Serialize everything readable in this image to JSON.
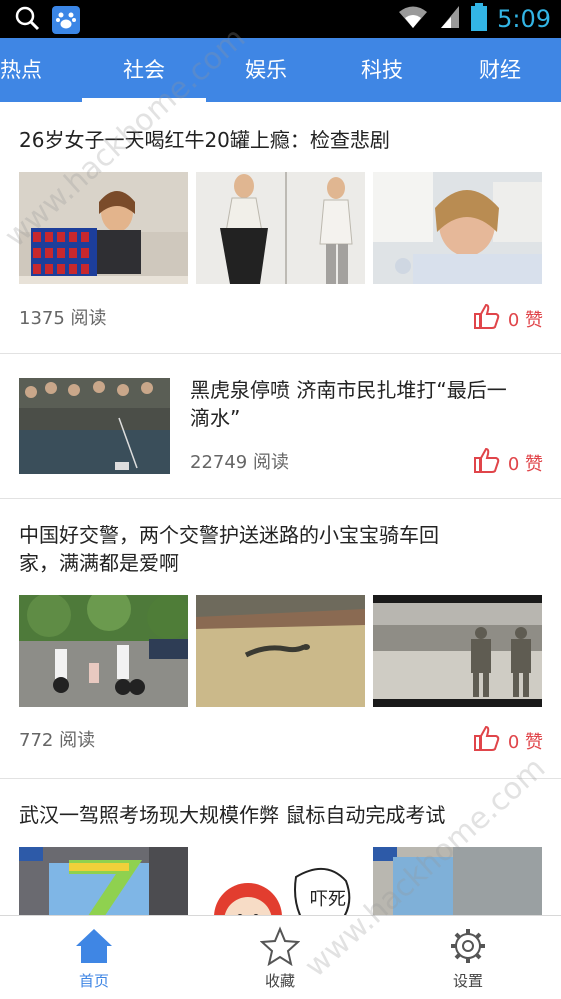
{
  "status_bar": {
    "time": "5:09"
  },
  "tabs": [
    {
      "label": "热点"
    },
    {
      "label": "社会"
    },
    {
      "label": "娱乐"
    },
    {
      "label": "科技"
    },
    {
      "label": "财经"
    }
  ],
  "articles": [
    {
      "title": "26岁女子一天喝红牛20罐上瘾：检查悲剧",
      "reads": "1375 阅读",
      "likes": "0 赞"
    },
    {
      "title_line1": "黑虎泉停喷 济南市民扎堆打“最后一",
      "title_line2": "滴水”",
      "reads": "22749 阅读",
      "likes": "0 赞"
    },
    {
      "title_line1": "中国好交警，两个交警护送迷路的小宝宝骑车回",
      "title_line2": "家，满满都是爱啊",
      "reads": "772 阅读",
      "likes": "0 赞"
    },
    {
      "title": "武汉一驾照考场现大规模作弊 鼠标自动完成考试"
    }
  ],
  "bottom_nav": [
    {
      "label": "首页"
    },
    {
      "label": "收藏"
    },
    {
      "label": "设置"
    }
  ],
  "watermark": {
    "text": "www.hackhome.com"
  },
  "colors": {
    "accent": "#3f86e4",
    "like": "#e0454a",
    "status_time": "#33b5e5"
  }
}
